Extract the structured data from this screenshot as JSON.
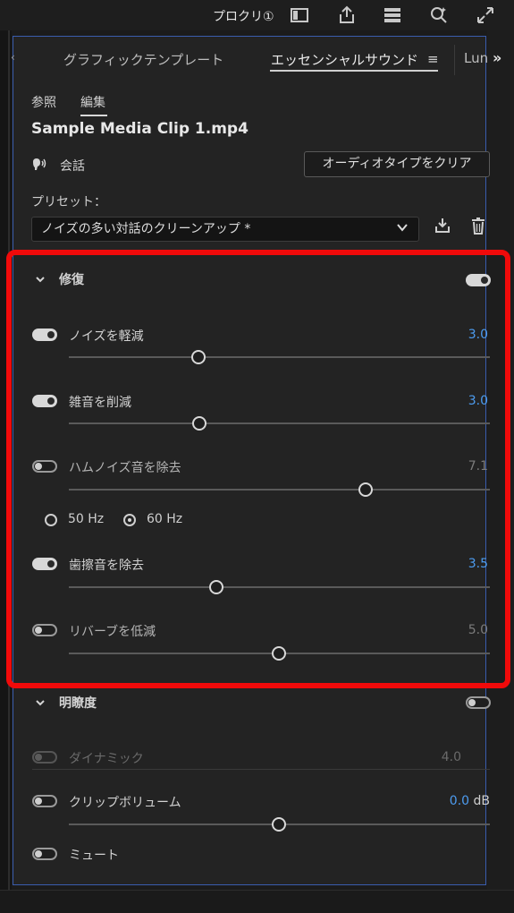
{
  "topbar": {
    "workspace": "プロクリ①",
    "icons": [
      "panel-icon",
      "export-icon",
      "layout-icon",
      "search-icon",
      "expand-icon"
    ]
  },
  "tabs": {
    "graphic_template": "グラフィックテンプレート",
    "essential_sound": "エッセンシャルサウンド",
    "lumetri": "Lun",
    "overflow": "»"
  },
  "subtabs": {
    "browse": "参照",
    "edit": "編集"
  },
  "clip_name": "Sample Media Clip 1.mp4",
  "audio_type": {
    "label": "会話",
    "clear_button": "オーディオタイプをクリア"
  },
  "preset": {
    "label": "プリセット：",
    "value": "ノイズの多い対話のクリーンアップ *"
  },
  "repair": {
    "title": "修復",
    "enabled": true,
    "rows": [
      {
        "label": "ノイズを軽減",
        "enabled": true,
        "value": "3.0",
        "level": 0.3
      },
      {
        "label": "雑音を削減",
        "enabled": true,
        "value": "3.0",
        "level": 0.3
      },
      {
        "label": "ハムノイズ音を除去",
        "enabled": false,
        "value": "7.1",
        "level": 0.71
      },
      {
        "label": "歯擦音を除去",
        "enabled": true,
        "value": "3.5",
        "level": 0.35
      },
      {
        "label": "リバーブを低減",
        "enabled": false,
        "value": "5.0",
        "level": 0.5
      }
    ],
    "hum_frequency": {
      "options": [
        "50 Hz",
        "60 Hz"
      ],
      "selected": "60 Hz"
    }
  },
  "clarity": {
    "title": "明瞭度",
    "enabled": false,
    "dynamics": {
      "label": "ダイナミック",
      "value": "4.0",
      "enabled": false
    }
  },
  "clip_volume": {
    "label": "クリップボリューム",
    "value": "0.0",
    "unit": "dB",
    "enabled": false,
    "level": 0.5
  },
  "mute": {
    "label": "ミュート",
    "enabled": false
  },
  "colors": {
    "accent_value": "#4d9cf0",
    "highlight_border": "#f00a0a",
    "panel_focus": "#3a5dae"
  }
}
